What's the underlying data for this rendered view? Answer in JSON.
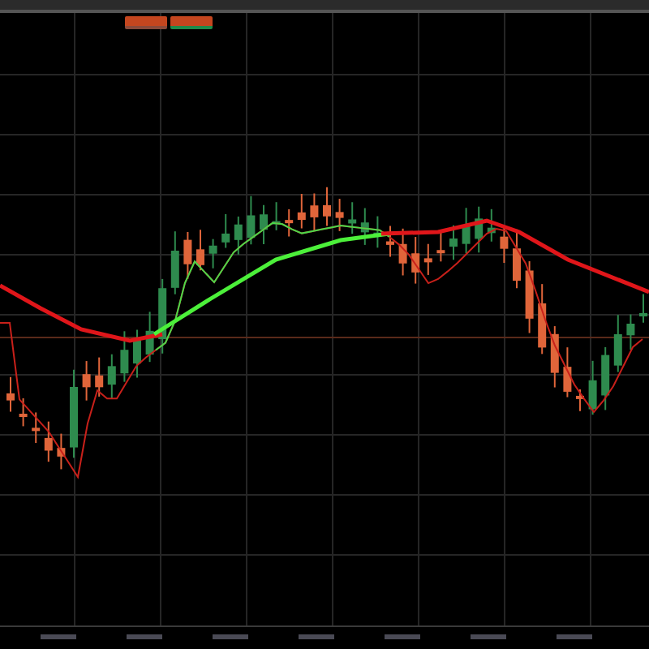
{
  "legend": [
    {
      "color": "#8a4a3a"
    },
    {
      "color": "#1f8a4a"
    }
  ]
}
